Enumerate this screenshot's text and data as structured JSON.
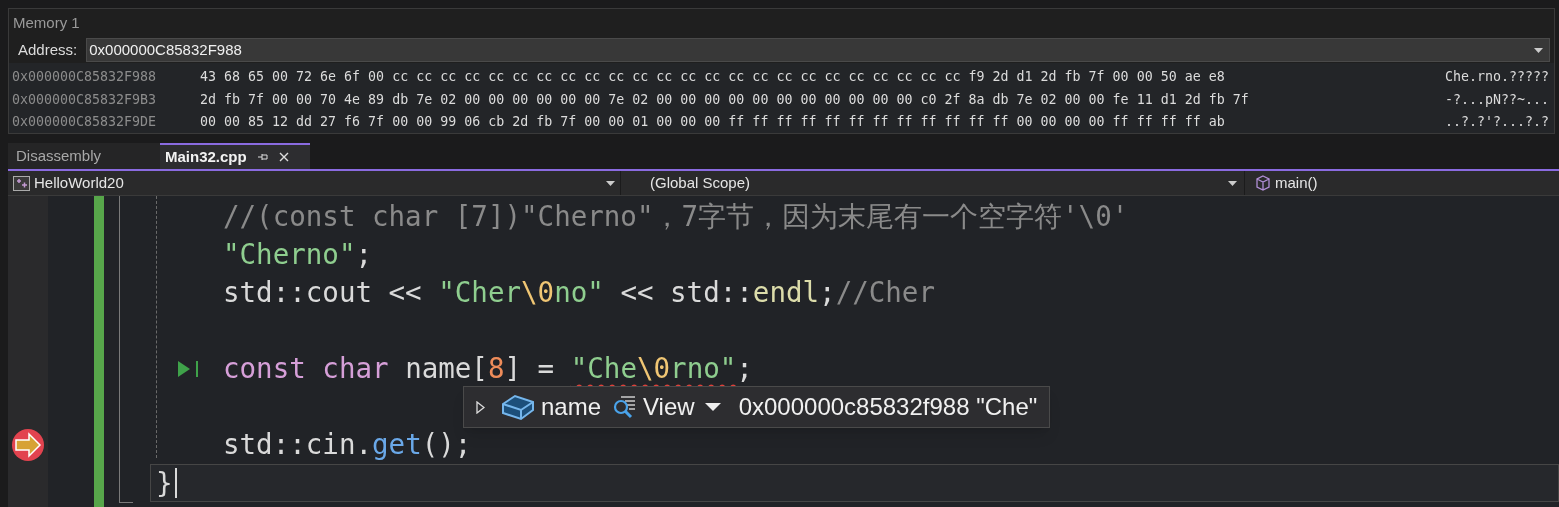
{
  "memory": {
    "title": "Memory 1",
    "address_label": "Address:",
    "address": "0x000000C85832F988",
    "rows": [
      {
        "address": "0x000000C85832F988",
        "bytes": "43 68 65 00 72 6e 6f 00 cc cc cc cc cc cc cc cc cc cc cc cc cc cc cc cc cc cc cc cc cc cc cc cc f9 2d d1 2d fb 7f 00 00 50 ae e8",
        "ascii": "Che.rno.?????"
      },
      {
        "address": "0x000000C85832F9B3",
        "bytes": "2d fb 7f 00 00 70 4e 89 db 7e 02 00 00 00 00 00 00 7e 02 00 00 00 00 00 00 00 00 00 00 00 c0 2f 8a db 7e 02 00 00 fe 11 d1 2d fb 7f",
        "ascii": "-?...pN??~..."
      },
      {
        "address": "0x000000C85832F9DE",
        "bytes": "00 00 85 12 dd 27 f6 7f 00 00 99 06 cb 2d fb 7f 00 00 01 00 00 00 ff ff ff ff ff ff ff ff ff ff ff ff 00 00 00 00 ff ff ff ff ab",
        "ascii": "..?.?'?...?.?"
      }
    ]
  },
  "tabs": [
    {
      "label": "Disassembly",
      "selected": false
    },
    {
      "label": "Main32.cpp",
      "selected": true
    }
  ],
  "nav_bar": {
    "project": "HelloWorld20",
    "scope": "(Global Scope)",
    "function": "main()"
  },
  "editor": {
    "lines": [
      {
        "kind": "code",
        "tokens": [
          {
            "text": "//(const char [7])\"Cherno\"，7字节，因为末尾有一个空字符'\\0'",
            "kind": "comment"
          }
        ]
      },
      {
        "kind": "code",
        "tokens": [
          {
            "text": "\"Cherno\"",
            "kind": "string"
          },
          {
            "text": ";",
            "kind": "plain"
          }
        ]
      },
      {
        "kind": "code",
        "tokens": [
          {
            "text": "std::cout << ",
            "kind": "plain"
          },
          {
            "text": "\"Cher",
            "kind": "string"
          },
          {
            "text": "\\0",
            "kind": "escape"
          },
          {
            "text": "no\"",
            "kind": "string"
          },
          {
            "text": " << std::",
            "kind": "plain"
          },
          {
            "text": "endl",
            "kind": "member"
          },
          {
            "text": ";",
            "kind": "plain"
          },
          {
            "text": "//Cher",
            "kind": "comment"
          }
        ]
      },
      {
        "kind": "blank"
      },
      {
        "kind": "code",
        "run_to_click": true,
        "tokens": [
          {
            "text": "const char",
            "kind": "keyword"
          },
          {
            "text": " name[",
            "kind": "plain"
          },
          {
            "text": "8",
            "kind": "number"
          },
          {
            "text": "] = ",
            "kind": "plain"
          },
          {
            "text": "\"Che",
            "kind": "string",
            "error": true
          },
          {
            "text": "\\0",
            "kind": "escape",
            "error": true
          },
          {
            "text": "rno\"",
            "kind": "string",
            "error": true
          },
          {
            "text": ";",
            "kind": "plain"
          }
        ]
      },
      {
        "kind": "blank"
      },
      {
        "kind": "code",
        "current": true,
        "tokens": [
          {
            "text": "std::cin.",
            "kind": "plain"
          },
          {
            "text": "get",
            "kind": "function"
          },
          {
            "text": "();",
            "kind": "plain"
          }
        ]
      },
      {
        "kind": "brace",
        "tokens": [
          {
            "text": "}",
            "kind": "plain"
          }
        ]
      }
    ]
  },
  "tooltip": {
    "name": "name",
    "view_label": "View",
    "value": "0x000000c85832f988 \"Che\""
  }
}
